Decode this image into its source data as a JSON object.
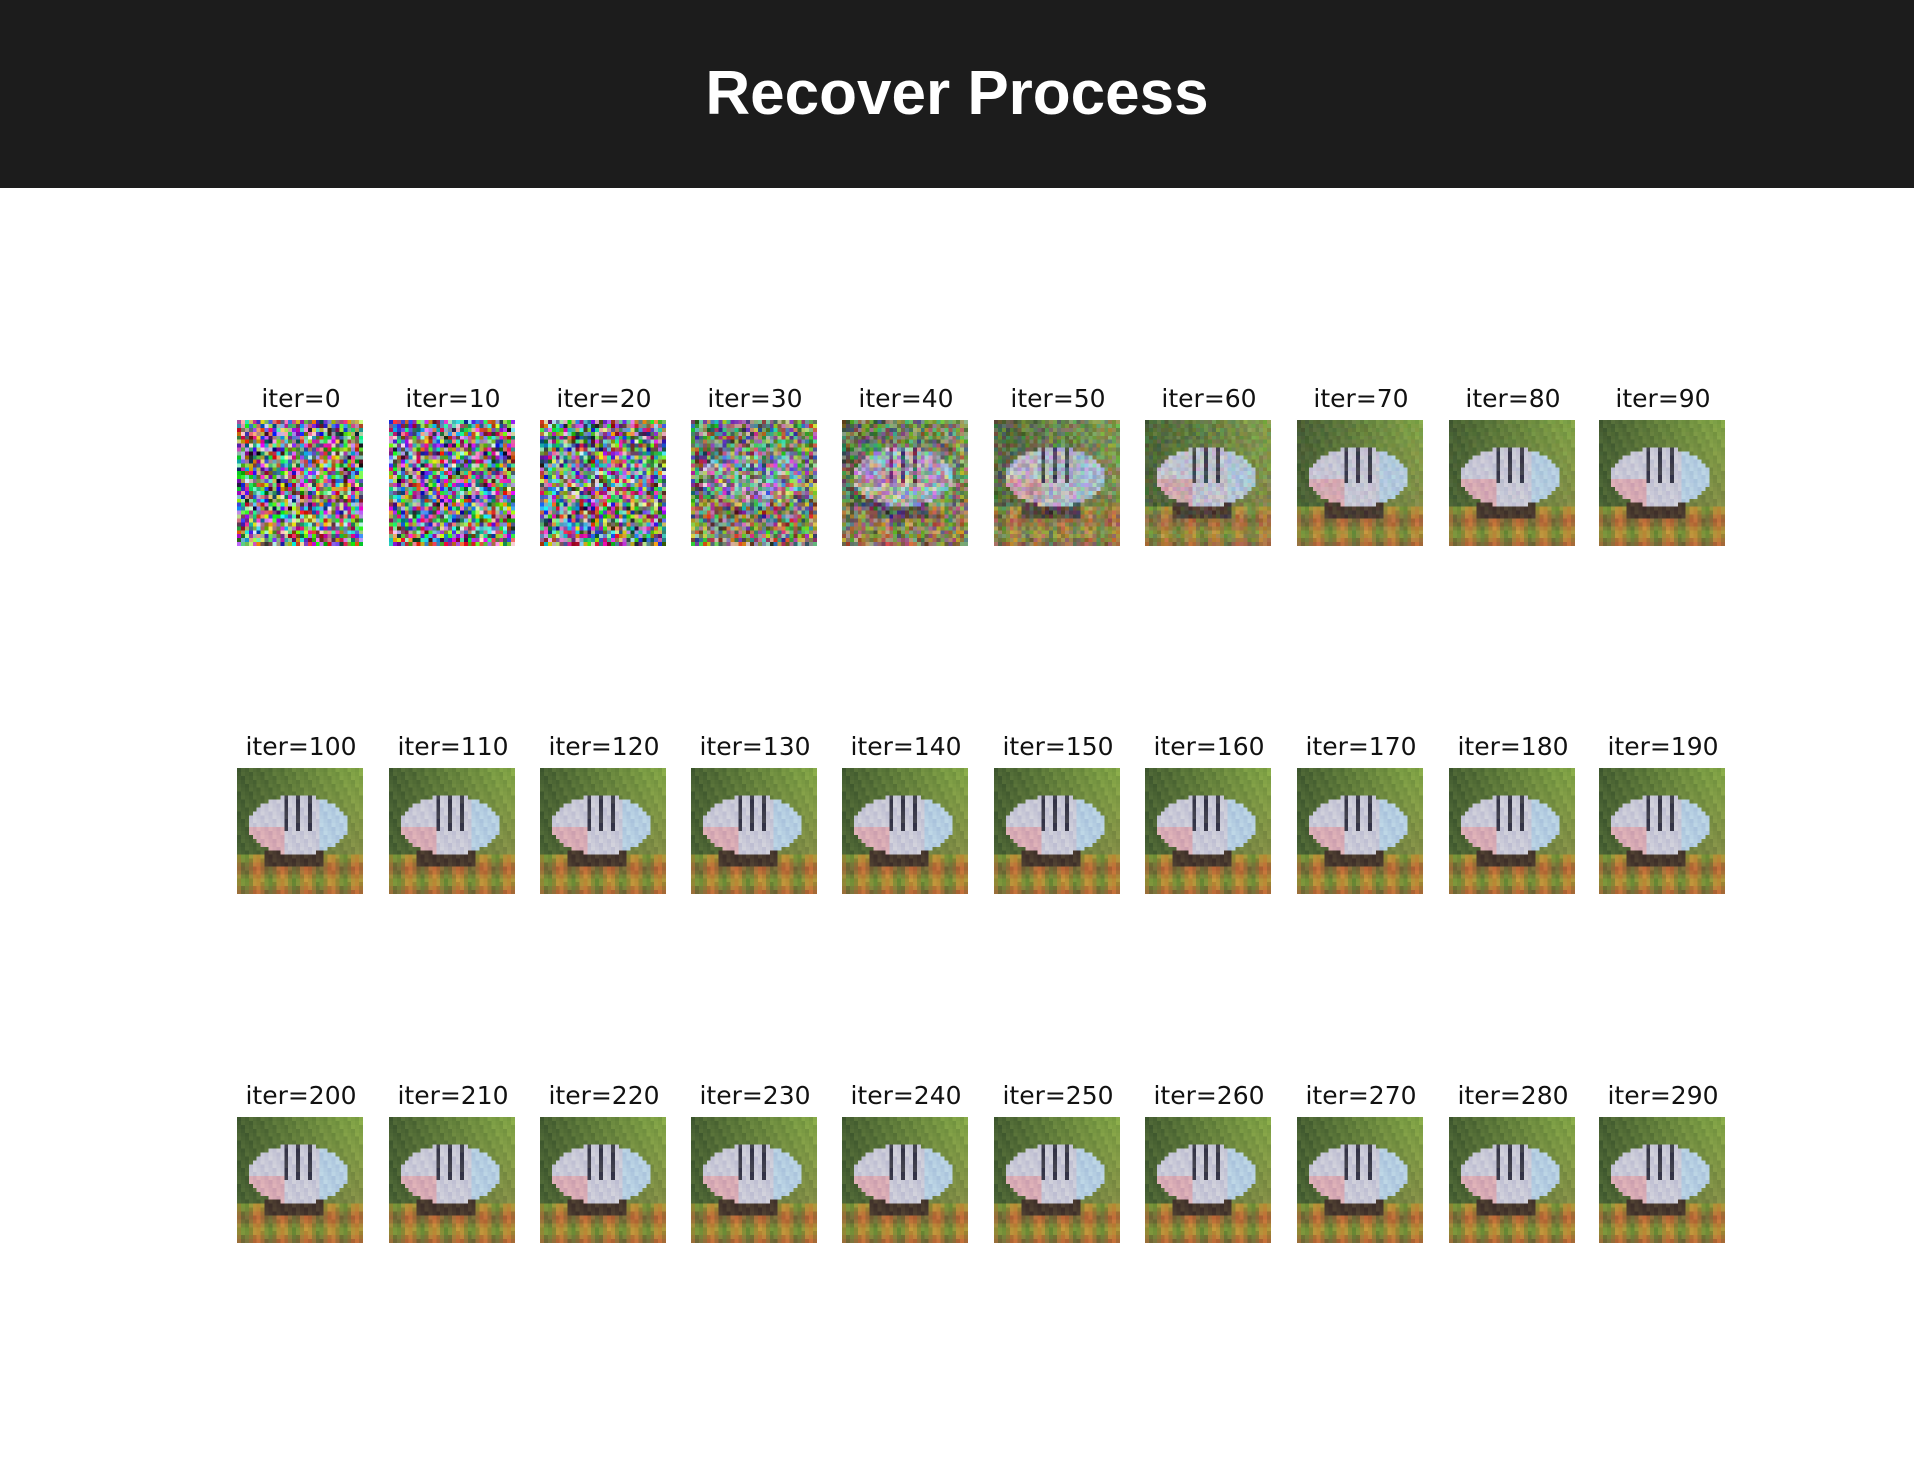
{
  "header": {
    "title": "Recover Process"
  },
  "grid": {
    "labels": [
      "iter=0",
      "iter=10",
      "iter=20",
      "iter=30",
      "iter=40",
      "iter=50",
      "iter=60",
      "iter=70",
      "iter=80",
      "iter=90",
      "iter=100",
      "iter=110",
      "iter=120",
      "iter=130",
      "iter=140",
      "iter=150",
      "iter=160",
      "iter=170",
      "iter=180",
      "iter=190",
      "iter=200",
      "iter=210",
      "iter=220",
      "iter=230",
      "iter=240",
      "iter=250",
      "iter=260",
      "iter=270",
      "iter=280",
      "iter=290"
    ],
    "noise_level": [
      1.0,
      1.0,
      0.95,
      0.7,
      0.45,
      0.25,
      0.12,
      0.04,
      0.02,
      0.01,
      0.0,
      0.0,
      0.0,
      0.0,
      0.0,
      0.0,
      0.0,
      0.0,
      0.0,
      0.0,
      0.0,
      0.0,
      0.0,
      0.0,
      0.0,
      0.0,
      0.0,
      0.0,
      0.0,
      0.0
    ]
  },
  "colors": {
    "header_bg": "#1c1c1c",
    "header_text": "#ffffff",
    "panel_bg": "#ffffff",
    "label_text": "#111111"
  },
  "image_subject": "reconstructed-fish-icon"
}
